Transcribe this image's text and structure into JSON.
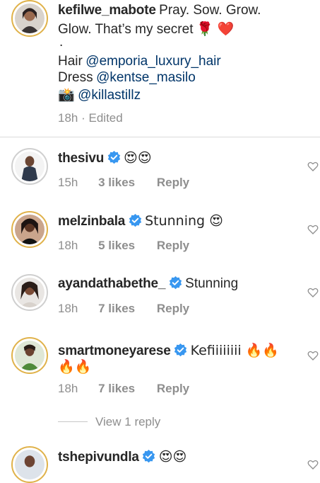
{
  "caption": {
    "username": "kefilwe_mabote",
    "line1": "Pray. Sow. Grow.",
    "line2": "Glow. That’s my secret",
    "line2_emoji": "🌹 ❤️",
    "dot": ".",
    "hair_label": "Hair",
    "hair_mention": "@emporia_luxury_hair",
    "dress_label": "Dress",
    "dress_mention": "@kentse_masilo",
    "camera_emoji": "📸",
    "camera_mention": "@killastillz",
    "time": "18h",
    "separator": "·",
    "edited": "Edited"
  },
  "comments": [
    {
      "username": "thesivu",
      "verified": true,
      "text": "😍😍",
      "time": "15h",
      "likes": "3 likes",
      "reply": "Reply"
    },
    {
      "username": "melzinbala",
      "verified": true,
      "text": "Stunning 😍",
      "time": "18h",
      "likes": "5 likes",
      "reply": "Reply"
    },
    {
      "username": "ayandathabethe_",
      "verified": true,
      "text": "Stunning",
      "time": "18h",
      "likes": "7 likes",
      "reply": "Reply"
    },
    {
      "username": "smartmoneyarese",
      "verified": true,
      "text": "Kefiiiiiiii 🔥🔥",
      "text2": "🔥🔥",
      "time": "18h",
      "likes": "7 likes",
      "reply": "Reply"
    }
  ],
  "view_replies": "View 1 reply",
  "next_comment": {
    "username": "tshepivundla",
    "text": "😍😍"
  },
  "colors": {
    "verified": "#3897f0",
    "meta": "#8e8e8e",
    "mention": "#003569",
    "ring": "#e0b24a"
  },
  "icons": {
    "like": "heart-outline-icon",
    "verified": "verified-badge-icon",
    "camera": "camera-flash-emoji"
  }
}
